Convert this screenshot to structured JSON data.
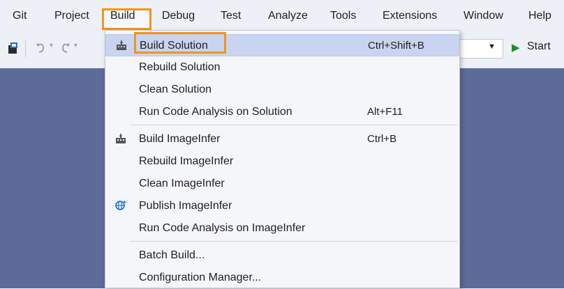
{
  "menubar": {
    "items": [
      "Git",
      "Project",
      "Build",
      "Debug",
      "Test",
      "Analyze",
      "Tools",
      "Extensions",
      "Window",
      "Help"
    ]
  },
  "toolbar": {
    "start_label": "Start"
  },
  "build_menu": {
    "items": [
      {
        "label": "Build Solution",
        "shortcut": "Ctrl+Shift+B",
        "icon": "build-icon"
      },
      {
        "label": "Rebuild Solution",
        "shortcut": ""
      },
      {
        "label": "Clean Solution",
        "shortcut": ""
      },
      {
        "label": "Run Code Analysis on Solution",
        "shortcut": "Alt+F11"
      },
      {
        "label": "Build ImageInfer",
        "shortcut": "Ctrl+B",
        "icon": "build-icon"
      },
      {
        "label": "Rebuild ImageInfer",
        "shortcut": ""
      },
      {
        "label": "Clean ImageInfer",
        "shortcut": ""
      },
      {
        "label": "Publish ImageInfer",
        "shortcut": "",
        "icon": "publish-globe-icon"
      },
      {
        "label": "Run Code Analysis on ImageInfer",
        "shortcut": ""
      },
      {
        "label": "Batch Build...",
        "shortcut": ""
      },
      {
        "label": "Configuration Manager...",
        "shortcut": ""
      }
    ]
  },
  "colors": {
    "highlight_border": "#f0961c",
    "selection_bg": "#c9d4f0",
    "editor_bg": "#5d6b99",
    "start_green": "#1a8f26"
  }
}
